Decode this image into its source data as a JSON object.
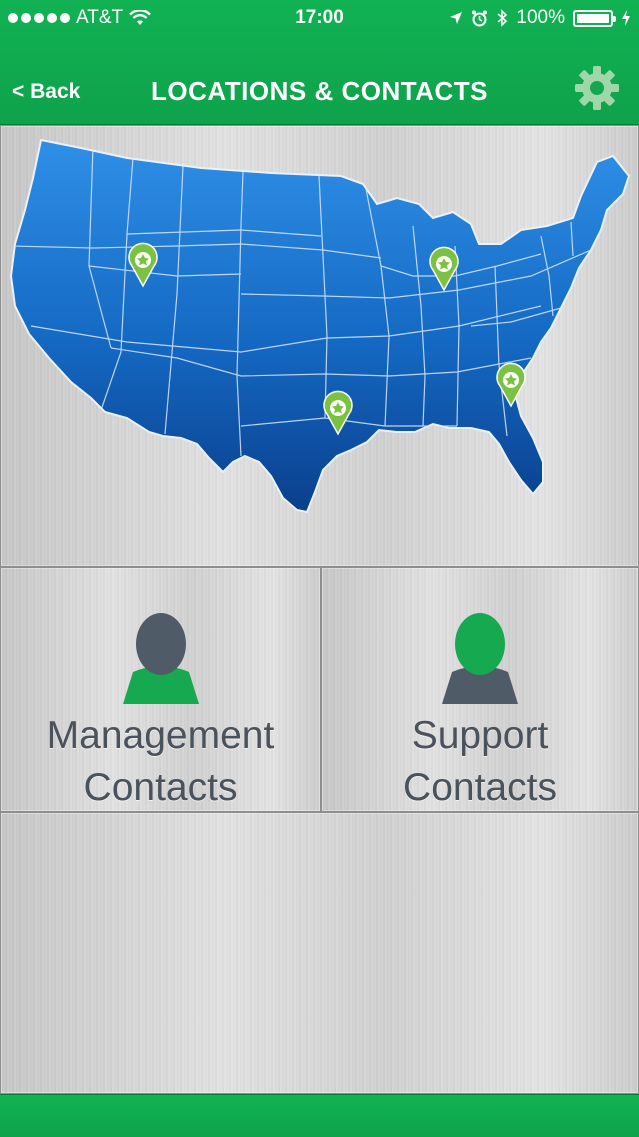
{
  "status_bar": {
    "carrier": "AT&T",
    "time": "17:00",
    "battery_percent": "100%",
    "battery_level": 1.0,
    "icons": [
      "wifi-icon",
      "location-arrow-icon",
      "alarm-icon",
      "bluetooth-icon",
      "battery-icon",
      "charging-icon"
    ]
  },
  "nav": {
    "back_label": "< Back",
    "title": "LOCATIONS & CONTACTS",
    "settings_icon": "gear-icon"
  },
  "map": {
    "icon": "usa-map",
    "pins": [
      "location-pin-utah",
      "location-pin-michigan",
      "location-pin-texas",
      "location-pin-south-carolina"
    ]
  },
  "tiles": {
    "management": {
      "line1": "Management",
      "line2": "Contacts",
      "icon": "person-icon"
    },
    "support": {
      "line1": "Support",
      "line2": "Contacts",
      "icon": "person-icon"
    }
  },
  "colors": {
    "brand_green": "#0fa64d",
    "map_blue": "#1e78d2",
    "pin_green": "#7cc242",
    "text_gray": "#4a535c",
    "person_dark": "#4f5b66"
  }
}
